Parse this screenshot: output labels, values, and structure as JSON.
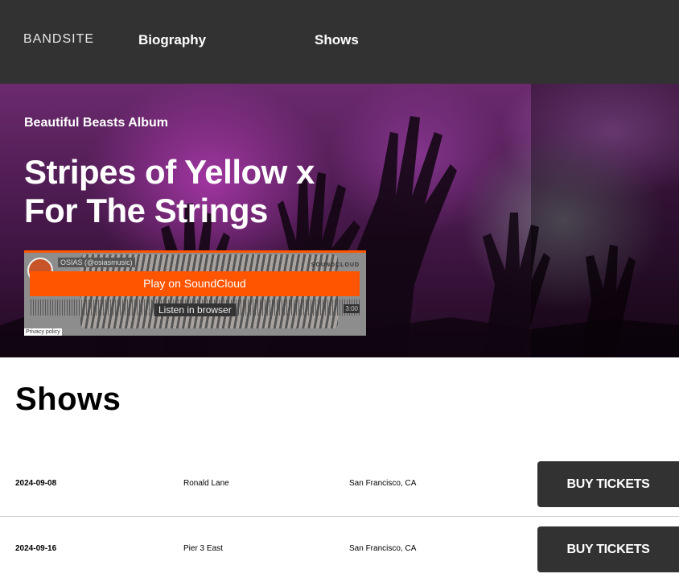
{
  "header": {
    "logo": "BANDSITE",
    "nav": [
      {
        "label": "Biography"
      },
      {
        "label": "Shows"
      }
    ]
  },
  "hero": {
    "subtitle": "Beautiful Beasts Album",
    "title": "Stripes of Yellow x For The Strings"
  },
  "soundcloud": {
    "user": "OSIAS (@osiasmusic)",
    "brand": "SOUNDCLOUD",
    "play_label": "Play on SoundCloud",
    "listen_label": "Listen in browser",
    "time": "3:00",
    "privacy": "Privacy policy",
    "accent": "#ff5500"
  },
  "shows": {
    "heading": "Shows",
    "rows": [
      {
        "date": "2024-09-08",
        "venue": "Ronald Lane",
        "location": "San Francisco, CA",
        "button": "BUY TICKETS"
      },
      {
        "date": "2024-09-16",
        "venue": "Pier 3 East",
        "location": "San Francisco, CA",
        "button": "BUY TICKETS"
      }
    ]
  },
  "colors": {
    "header_bg": "#323232",
    "button_bg": "#323232"
  }
}
